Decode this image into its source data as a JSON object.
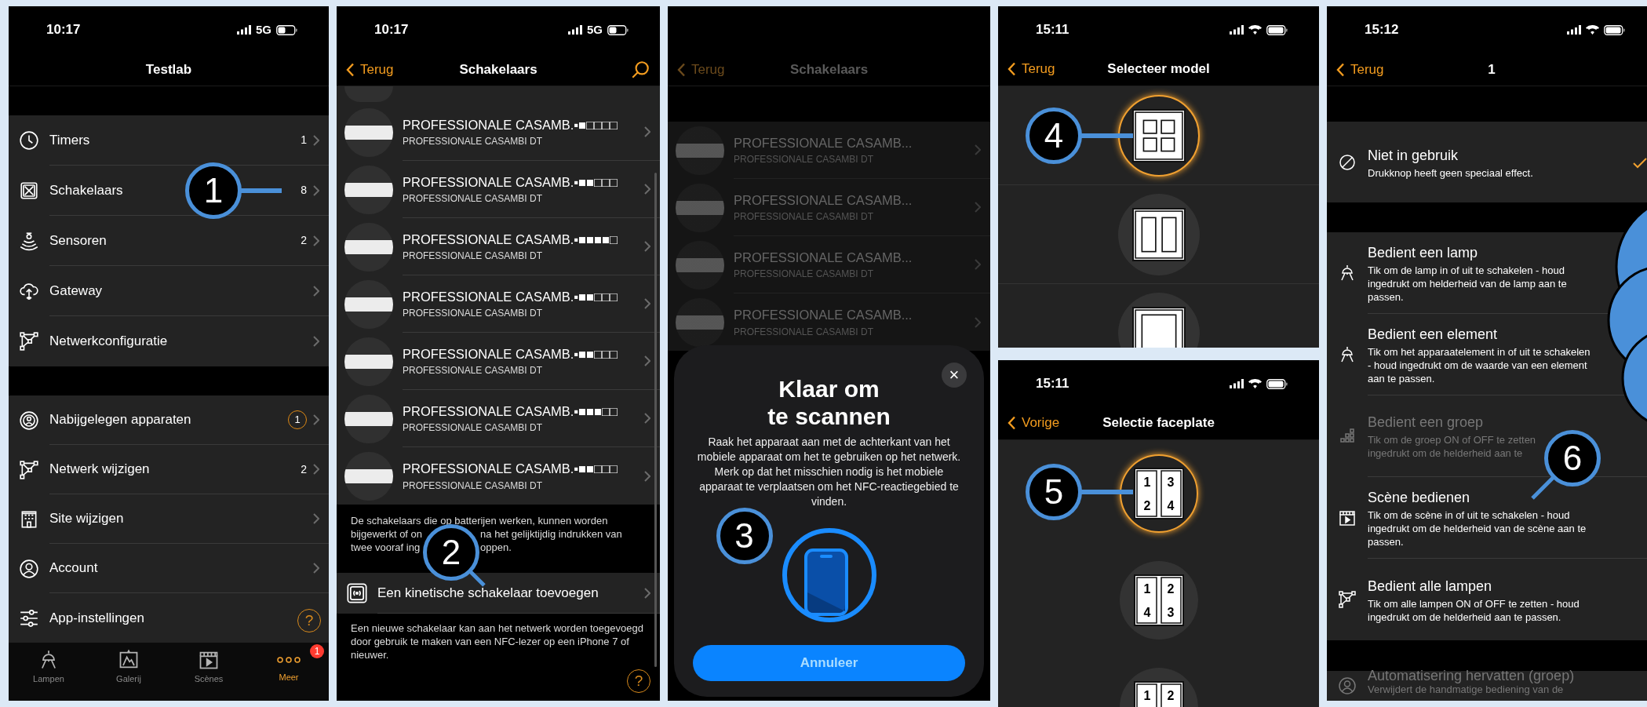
{
  "callouts": [
    "1",
    "2",
    "3",
    "4",
    "5",
    "6"
  ],
  "menu_screen": {
    "status": {
      "time": "10:17",
      "network_label": "5G"
    },
    "title": "Testlab",
    "groups": [
      [
        {
          "label": "Timers",
          "count": "1",
          "chevron": true
        },
        {
          "label": "Schakelaars",
          "count": "8",
          "chevron": true
        },
        {
          "label": "Sensoren",
          "count": "2",
          "chevron": true
        },
        {
          "label": "Gateway",
          "chevron": true
        },
        {
          "label": "Netwerkconfiguratie",
          "chevron": true
        }
      ],
      [
        {
          "label": "Nabijgelegen apparaten",
          "ringed_count": "1",
          "chevron": true
        },
        {
          "label": "Netwerk wijzigen",
          "count": "2",
          "chevron": true
        },
        {
          "label": "Site wijzigen",
          "chevron": true
        },
        {
          "label": "Account",
          "chevron": true
        },
        {
          "label": "App-instellingen",
          "chevron": false
        }
      ]
    ],
    "help": "?",
    "tabs": [
      {
        "label": "Lampen",
        "selected": false
      },
      {
        "label": "Galerij",
        "selected": false
      },
      {
        "label": "Scènes",
        "selected": false
      },
      {
        "label": "Meer",
        "selected": true,
        "badge": "1"
      }
    ]
  },
  "switches_screen": {
    "status": {
      "time": "10:17",
      "network_label": "5G"
    },
    "back": "Terug",
    "title": "Schakelaars",
    "rows": [
      {
        "title": "PROFESSIONALE CASAMB.▪■□□□□",
        "subtitle": "PROFESSIONALE CASAMBI DT"
      },
      {
        "title": "PROFESSIONALE CASAMB.▪■■□□□",
        "subtitle": "PROFESSIONALE CASAMBI DT"
      },
      {
        "title": "PROFESSIONALE CASAMB.▪■■■■□",
        "subtitle": "PROFESSIONALE CASAMBI DT"
      },
      {
        "title": "PROFESSIONALE CASAMB.▪■■□□□",
        "subtitle": "PROFESSIONALE CASAMBI DT"
      },
      {
        "title": "PROFESSIONALE CASAMB.▪■■□□□",
        "subtitle": "PROFESSIONALE CASAMBI DT"
      },
      {
        "title": "PROFESSIONALE CASAMB.▪■■■□□",
        "subtitle": "PROFESSIONALE CASAMBI DT"
      },
      {
        "title": "PROFESSIONALE CASAMB.▪■■□□□",
        "subtitle": "PROFESSIONALE CASAMBI DT"
      }
    ],
    "note": [
      [
        "De schakelaars die op batterijen werken, kunnen worden"
      ],
      [
        "bijgewerkt of on",
        "na het gelijktijdig indrukken van"
      ],
      [
        "twee vooraf ing",
        "oppen."
      ]
    ],
    "action": "Een kinetische schakelaar toevoegen",
    "footer": "Een nieuwe schakelaar kan aan het netwerk worden toegevoegd door gebruik te maken van een NFC-lezer op een iPhone 7 of nieuwer.",
    "help": "?"
  },
  "scan_screen": {
    "back": "Terug",
    "title": "Schakelaars",
    "rows": [
      {
        "title": "PROFESSIONALE CASAMB...",
        "subtitle": "PROFESSIONALE CASAMBI DT"
      },
      {
        "title": "PROFESSIONALE CASAMB...",
        "subtitle": "PROFESSIONALE CASAMBI DT"
      },
      {
        "title": "PROFESSIONALE CASAMB...",
        "subtitle": "PROFESSIONALE CASAMBI DT"
      },
      {
        "title": "PROFESSIONALE CASAMB...",
        "subtitle": "PROFESSIONALE CASAMBI DT"
      }
    ],
    "sheet": {
      "close": "×",
      "title": "Klaar om te scannen",
      "text": "Raak het apparaat aan met de achterkant van het mobiele apparaat om het te gebruiken op het netwerk. Merk op dat het misschien nodig is het mobiele apparaat te verplaatsen om het NFC-reactiegebied te vinden.",
      "button": "Annuleer"
    }
  },
  "model_screen": {
    "status": {
      "time": "15:11",
      "wifi": true
    },
    "back": "Terug",
    "title": "Selecteer model",
    "models": [
      {
        "kind": "quad",
        "selected": true
      },
      {
        "kind": "dual",
        "selected": false
      },
      {
        "kind": "single",
        "selected": false
      }
    ]
  },
  "faceplate_screen": {
    "status": {
      "time": "15:11",
      "wifi": true
    },
    "back": "Vorige",
    "title": "Selectie faceplate",
    "plates": [
      {
        "labels": [
          "1",
          "3",
          "2",
          "4"
        ],
        "selected": true
      },
      {
        "labels": [
          "1",
          "2",
          "4",
          "3"
        ],
        "selected": false
      },
      {
        "labels": [
          "1",
          "2"
        ],
        "selected": false
      }
    ]
  },
  "button_screen": {
    "status": {
      "time": "15:12",
      "wifi": true
    },
    "back": "Terug",
    "title": "1",
    "groups": [
      [
        {
          "label": "Niet in gebruik",
          "description": "Drukknop heeft geen speciaal effect.",
          "selected": true,
          "disabled": false
        }
      ],
      [
        {
          "label": "Bedient een lamp",
          "description": "Tik om de lamp in of uit te schakelen - houd ingedrukt om helderheid van de lamp aan te passen.",
          "selected": false,
          "disabled": false
        },
        {
          "label": "Bedient een element",
          "description": "Tik om het apparaatelement in of uit te schakelen - houd ingedrukt om de waarde van een element aan te passen.",
          "selected": false,
          "disabled": false
        },
        {
          "label": "Bedient een groep",
          "description": "Tik om de groep ON of OFF te zetten\ningedrukt om de helderheid aan te",
          "selected": false,
          "disabled": true
        },
        {
          "label": "Scène bedienen",
          "description": "Tik om de scène in of uit te schakelen - houd ingedrukt om de helderheid van de scène aan te passen.",
          "selected": false,
          "disabled": false
        },
        {
          "label": "Bedient alle lampen",
          "description": "Tik om alle lampen ON of OFF te zetten - houd ingedrukt om de helderheid aan te passen.",
          "selected": false,
          "disabled": false
        }
      ],
      [
        {
          "label": "Automatisering hervatten (groep)",
          "description": "Verwijdert de handmatige bediening van de",
          "selected": false,
          "disabled": true
        }
      ]
    ]
  }
}
